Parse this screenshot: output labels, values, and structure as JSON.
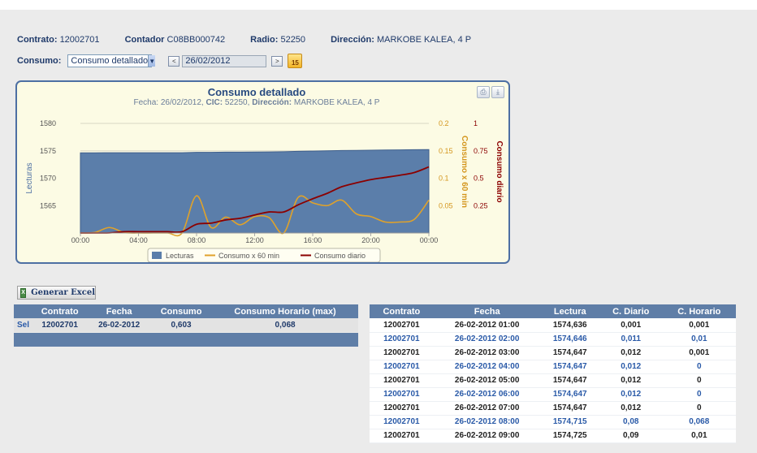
{
  "info": {
    "contrato_label": "Contrato:",
    "contrato_value": "12002701",
    "contador_label": "Contador",
    "contador_value": "C08BB000742",
    "radio_label": "Radio:",
    "radio_value": "52250",
    "direccion_label": "Dirección:",
    "direccion_value": "MARKOBE KALEA, 4 P"
  },
  "consumo": {
    "label": "Consumo:",
    "selected": "Consumo detallado",
    "prev": "<",
    "date": "26/02/2012",
    "next": ">",
    "calendar_day": "15"
  },
  "chart_data": {
    "type": "line",
    "title": "Consumo detallado",
    "subtitle_fecha_label": "Fecha:",
    "subtitle_fecha": "26/02/2012,",
    "subtitle_cic_label": "CIC:",
    "subtitle_cic": "52250,",
    "subtitle_dir_label": "Dirección:",
    "subtitle_dir": "MARKOBE KALEA, 4 P",
    "x_ticks": [
      "00:00",
      "04:00",
      "08:00",
      "12:00",
      "16:00",
      "20:00",
      "00:00"
    ],
    "y_left": {
      "label": "Lecturas",
      "ticks": [
        "1580",
        "1575",
        "1570",
        "1565"
      ],
      "ylim": [
        1560,
        1580
      ]
    },
    "y_mid": {
      "label": "Consumo x 60 min",
      "ticks": [
        "0.2",
        "0.15",
        "0.1",
        "0.05"
      ],
      "ylim": [
        0,
        0.2
      ]
    },
    "y_right": {
      "label": "Consumo diario",
      "ticks": [
        "1",
        "0.75",
        "0.5",
        "0.25"
      ],
      "ylim": [
        0,
        1
      ]
    },
    "series": [
      {
        "name": "Lecturas",
        "color": "#5b7eaa",
        "x": [
          0,
          1,
          2,
          3,
          4,
          5,
          6,
          7,
          8,
          9,
          10,
          11,
          12,
          13,
          14,
          15,
          16,
          17,
          18,
          19,
          20,
          21,
          22,
          23,
          24
        ],
        "values": [
          1574.635,
          1574.636,
          1574.646,
          1574.647,
          1574.647,
          1574.647,
          1574.647,
          1574.647,
          1574.715,
          1574.725,
          1574.754,
          1574.76,
          1574.78,
          1574.8,
          1574.84,
          1574.9,
          1574.95,
          1575.0,
          1575.05,
          1575.08,
          1575.12,
          1575.15,
          1575.17,
          1575.2,
          1575.23
        ]
      },
      {
        "name": "Consumo x 60 min",
        "color": "#e0a22a",
        "x": [
          0,
          1,
          2,
          3,
          4,
          5,
          6,
          7,
          8,
          9,
          10,
          11,
          12,
          13,
          14,
          15,
          16,
          17,
          18,
          19,
          20,
          21,
          22,
          23,
          24
        ],
        "values": [
          0,
          0.001,
          0.01,
          0.001,
          0,
          0,
          0,
          0,
          0.068,
          0.01,
          0.029,
          0.015,
          0.03,
          0.028,
          0,
          0.065,
          0.055,
          0.05,
          0.06,
          0.035,
          0.03,
          0.02,
          0.02,
          0.025,
          0.06
        ]
      },
      {
        "name": "Consumo diario",
        "color": "#8b0000",
        "x": [
          0,
          1,
          2,
          3,
          4,
          5,
          6,
          7,
          8,
          9,
          10,
          11,
          12,
          13,
          14,
          15,
          16,
          17,
          18,
          19,
          20,
          21,
          22,
          23,
          24
        ],
        "values": [
          0,
          0,
          0.001,
          0.012,
          0.012,
          0.012,
          0.012,
          0.012,
          0.08,
          0.09,
          0.119,
          0.134,
          0.164,
          0.192,
          0.192,
          0.257,
          0.312,
          0.362,
          0.422,
          0.457,
          0.487,
          0.507,
          0.527,
          0.552,
          0.603
        ]
      }
    ],
    "legend": [
      "Lecturas",
      "Consumo x 60 min",
      "Consumo diario"
    ],
    "legend_placement": "bottom",
    "grid": true
  },
  "excel_button": "Generar Excel",
  "left_table": {
    "headers": [
      "Contrato",
      "Fecha",
      "Consumo",
      "Consumo Horario (max)"
    ],
    "rows": [
      [
        "Sel",
        "12002701",
        "26-02-2012",
        "0,603",
        "0,068"
      ]
    ]
  },
  "right_table": {
    "headers": [
      "Contrato",
      "Fecha",
      "Lectura",
      "C. Diario",
      "C. Horario"
    ],
    "rows": [
      [
        "12002701",
        "26-02-2012 01:00",
        "1574,636",
        "0,001",
        "0,001"
      ],
      [
        "12002701",
        "26-02-2012 02:00",
        "1574,646",
        "0,011",
        "0,01"
      ],
      [
        "12002701",
        "26-02-2012 03:00",
        "1574,647",
        "0,012",
        "0,001"
      ],
      [
        "12002701",
        "26-02-2012 04:00",
        "1574,647",
        "0,012",
        "0"
      ],
      [
        "12002701",
        "26-02-2012 05:00",
        "1574,647",
        "0,012",
        "0"
      ],
      [
        "12002701",
        "26-02-2012 06:00",
        "1574,647",
        "0,012",
        "0"
      ],
      [
        "12002701",
        "26-02-2012 07:00",
        "1574,647",
        "0,012",
        "0"
      ],
      [
        "12002701",
        "26-02-2012 08:00",
        "1574,715",
        "0,08",
        "0,068"
      ],
      [
        "12002701",
        "26-02-2012 09:00",
        "1574,725",
        "0,09",
        "0,01"
      ]
    ]
  }
}
